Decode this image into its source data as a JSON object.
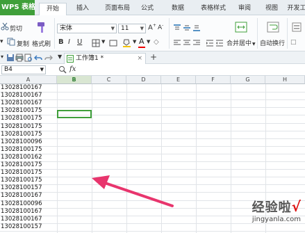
{
  "app": {
    "name": "WPS 表格",
    "tabs": [
      "开始",
      "插入",
      "页面布局",
      "公式",
      "数据",
      "表格样式",
      "审阅",
      "视图",
      "开发工"
    ],
    "active_tab": "开始"
  },
  "ribbon": {
    "cut": "剪切",
    "copy": "复制",
    "format_painter": "格式刷",
    "font_name": "宋体",
    "font_size": "11",
    "merge_center": "合并居中",
    "wrap_text": "自动换行",
    "bold": "B",
    "italic": "I",
    "underline": "U",
    "font_color_letter": "A"
  },
  "document": {
    "tab_title": "工作簿1 *"
  },
  "formula_bar": {
    "name_box": "B4",
    "fx": "fx"
  },
  "sheet": {
    "columns": [
      "A",
      "B",
      "C",
      "D",
      "E",
      "F",
      "G",
      "H"
    ],
    "selected_column": "B",
    "column_a_values": [
      "13028100167",
      "13028100167",
      "13028100167",
      "13028100175",
      "13028100175",
      "13028100175",
      "13028100175",
      "13028100096",
      "13028100175",
      "13028100162",
      "13028100175",
      "13028100175",
      "13028100175",
      "13028100157",
      "13028100167",
      "13028100096",
      "13028100167",
      "13028100167",
      "13028100157"
    ]
  },
  "annotation": {
    "arrow_color": "#e8356d"
  },
  "watermark": {
    "main": "经验啦",
    "check": "√",
    "url": "jingyanla.com"
  }
}
